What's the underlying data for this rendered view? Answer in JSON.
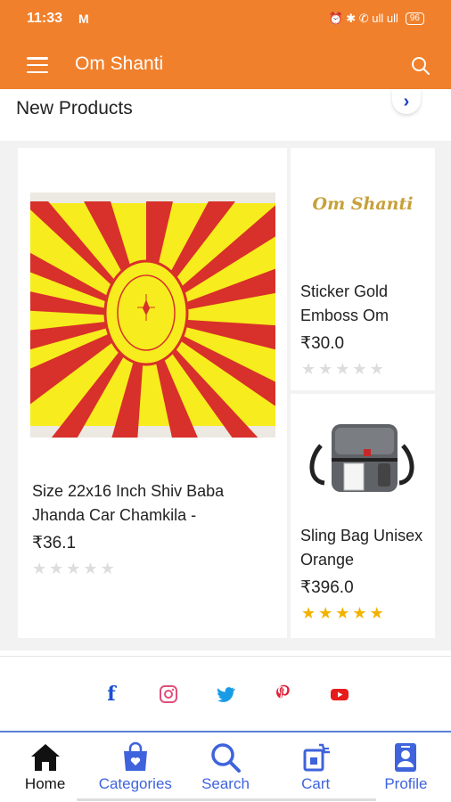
{
  "status_bar": {
    "time": "11:33",
    "mail_indicator": "M",
    "right_icons": "⏰ ✱ ✆ ull ull",
    "battery": "96"
  },
  "app_bar": {
    "title": "Om Shanti"
  },
  "section": {
    "title": "New Products",
    "next_arrow": "›"
  },
  "products": [
    {
      "name": "Size 22x16 Inch Shiv Baba Jhanda Car Chamkila -",
      "price": "₹36.1",
      "rating_filled": 0,
      "rating_total": 5
    },
    {
      "name": "Sticker Gold Emboss Om",
      "image_text": "Om Shanti",
      "price": "₹30.0",
      "rating_filled": 0,
      "rating_total": 5
    },
    {
      "name": "Sling Bag Unisex Orange",
      "price": "₹396.0",
      "rating_filled": 5,
      "rating_total": 5
    }
  ],
  "social": [
    "f",
    "instagram",
    "twitter",
    "pinterest",
    "youtube"
  ],
  "bottom_nav": [
    {
      "label": "Home",
      "icon": "home-icon"
    },
    {
      "label": "Categories",
      "icon": "bag-icon"
    },
    {
      "label": "Search",
      "icon": "search-icon"
    },
    {
      "label": "Cart",
      "icon": "cart-icon"
    },
    {
      "label": "Profile",
      "icon": "profile-icon"
    }
  ],
  "colors": {
    "primary": "#f0802c",
    "nav_blue": "#3f63dc",
    "star": "#f2b300"
  }
}
